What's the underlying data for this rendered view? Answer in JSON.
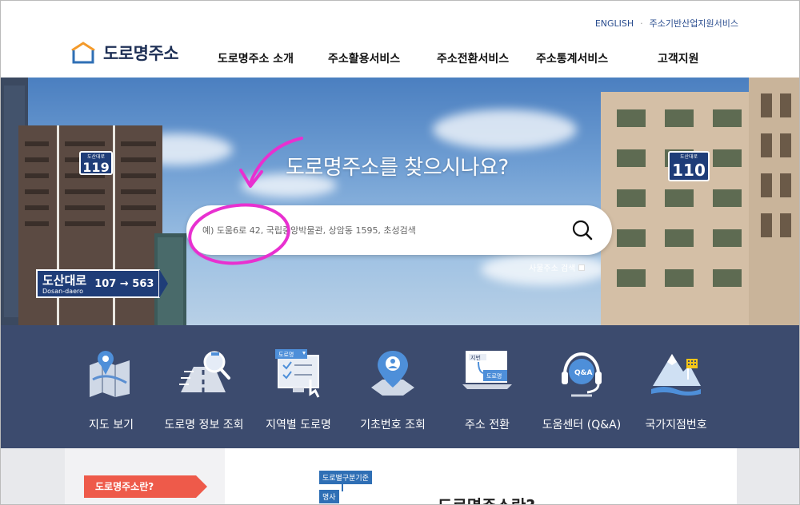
{
  "header": {
    "util_links": [
      "ENGLISH",
      "주소기반산업지원서비스"
    ],
    "logo_text": "도로명주소",
    "nav": [
      "도로명주소 소개",
      "주소활용서비스",
      "주소전환서비스",
      "주소통계서비스",
      "고객지원"
    ]
  },
  "hero": {
    "title": "도로명주소를 찾으시나요?",
    "search_placeholder": "예) 도움6로 42, 국립중앙박물관, 상암동 1595, 초성검색",
    "subcheck_label": "사물주소 검색",
    "sign_left": {
      "top": "도산대로",
      "num": "119"
    },
    "sign_right": {
      "top": "도산대로",
      "num": "110"
    },
    "road_sign": {
      "name": "도산대로",
      "en": "Dosan-daero",
      "num": "107 → 563"
    }
  },
  "quick_menu": [
    {
      "label": "지도 보기",
      "icon": "map-icon"
    },
    {
      "label": "도로명 정보 조회",
      "icon": "road-search-icon"
    },
    {
      "label": "지역별 도로명",
      "icon": "region-list-icon"
    },
    {
      "label": "기초번호 조회",
      "icon": "location-pin-icon"
    },
    {
      "label": "주소 전환",
      "icon": "address-convert-icon"
    },
    {
      "label": "도움센터 (Q&A)",
      "icon": "headset-icon"
    },
    {
      "label": "국가지점번호",
      "icon": "mountain-marker-icon"
    }
  ],
  "quick_menu_icon_labels": {
    "region": "도로명",
    "convert_from": "지번",
    "convert_to": "도로명",
    "qa": "Q&A"
  },
  "content": {
    "tag": "도로명주소란?",
    "mini_tag_1": "도로별구분기준",
    "mini_tag_2": "명사",
    "heading": "도로명주소란?"
  },
  "colors": {
    "brand_navy": "#1d2f55",
    "quick_band": "#3c4b6e",
    "accent_red": "#ee5a4a",
    "annotation": "#e830d0"
  }
}
